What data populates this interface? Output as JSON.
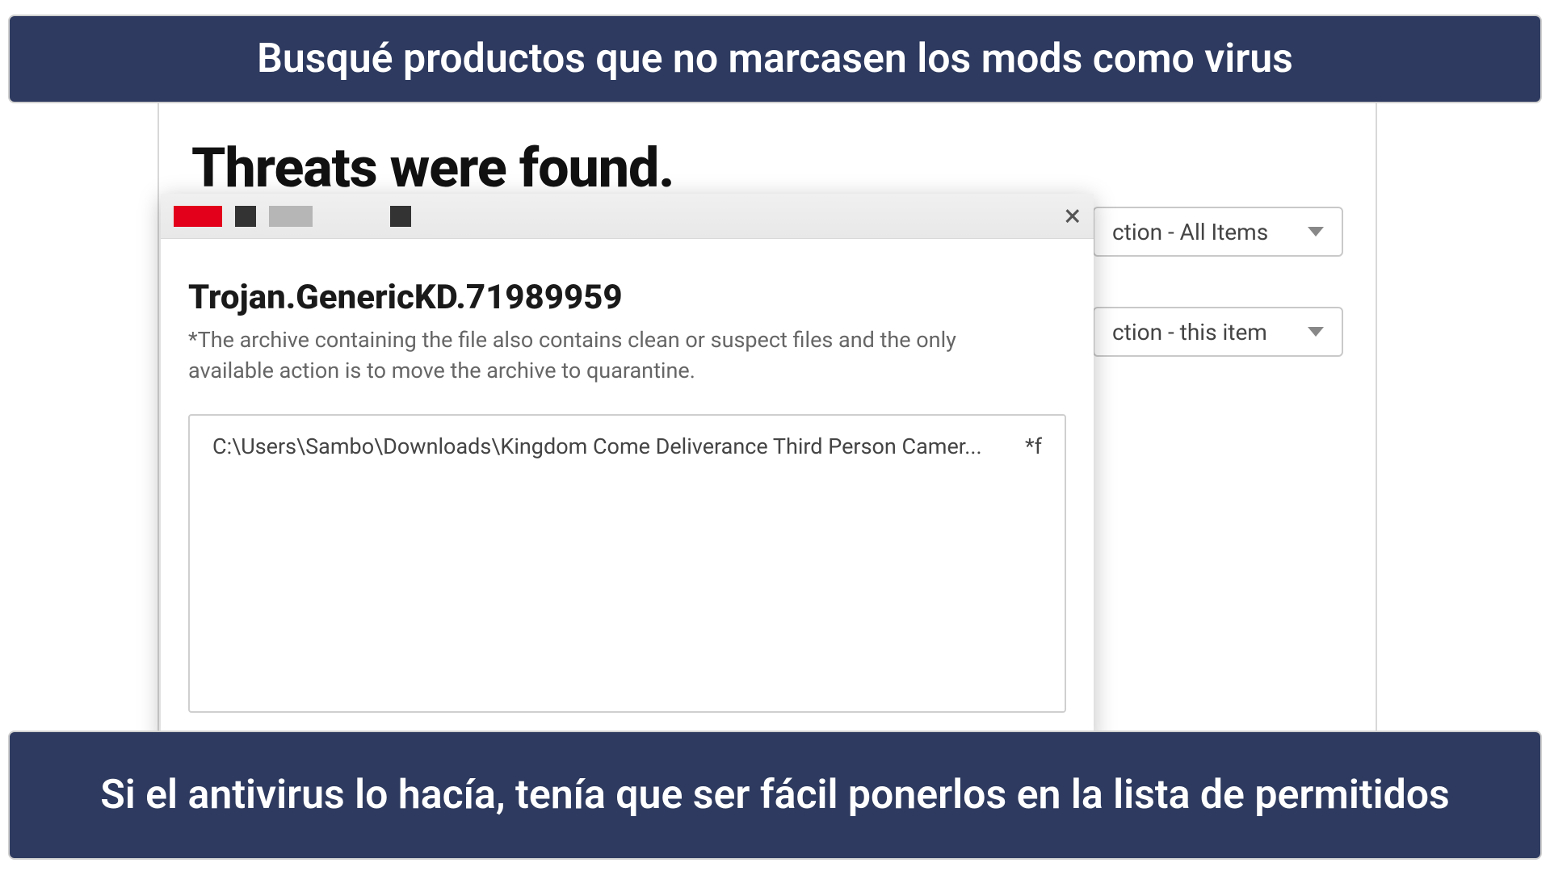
{
  "banners": {
    "top": "Busqué productos que no marcasen los mods como virus",
    "bottom": "Si el antivirus lo hacía, tenía que ser fácil ponerlos en la lista de permitidos"
  },
  "main": {
    "title": "Threats were found.",
    "dropdown_all": "ction - All Items",
    "dropdown_item": "ction - this item"
  },
  "dialog": {
    "threat": "Trojan.GenericKD.71989959",
    "note": "*The archive containing the file also contains clean or suspect files and the only available action is to move the archive to quarantine.",
    "filepath": "C:\\Users\\Sambo\\Downloads\\Kingdom Come Deliverance Third Person Camer...",
    "filetag": "*f",
    "close": "×"
  }
}
